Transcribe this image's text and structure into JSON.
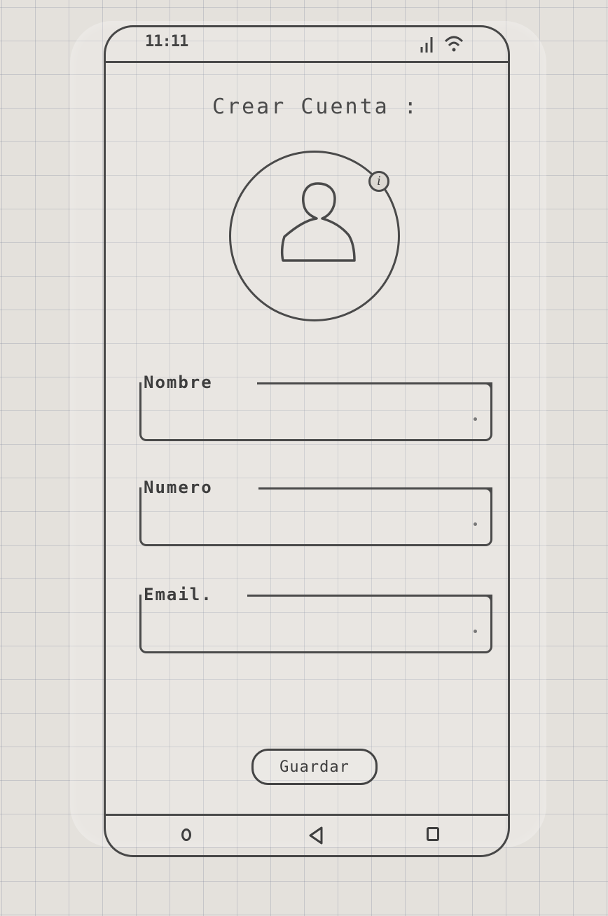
{
  "status_bar": {
    "time": "11:11",
    "signal_icon": "signal-bars-icon",
    "wifi_icon": "wifi-icon"
  },
  "screen": {
    "title": "Crear Cuenta :"
  },
  "profile_photo": {
    "icon": "user-silhouette-icon",
    "edit_icon": "info-icon",
    "edit_glyph": "i"
  },
  "form": {
    "fields": [
      {
        "label": "Nombre",
        "value": "",
        "placeholder": ""
      },
      {
        "label": "Numero",
        "value": "",
        "placeholder": ""
      },
      {
        "label": "Email.",
        "value": "",
        "placeholder": ""
      }
    ]
  },
  "actions": {
    "save_label": "Guardar"
  },
  "nav_bar": {
    "home_icon": "home-circle-icon",
    "back_icon": "back-triangle-icon",
    "recents_icon": "recents-square-icon"
  }
}
